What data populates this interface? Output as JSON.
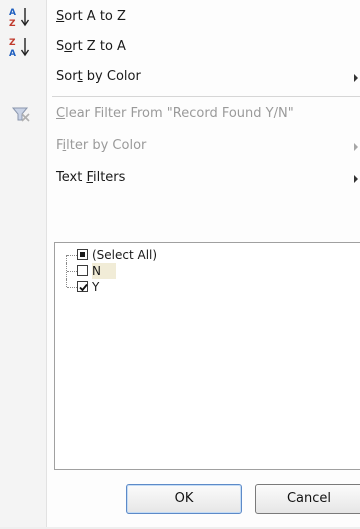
{
  "menu": {
    "sort_asc": {
      "pre": "",
      "key": "S",
      "post": "ort A to Z",
      "icon": "sort-a-to-z-icon"
    },
    "sort_desc": {
      "pre": "S",
      "key": "o",
      "post": "rt Z to A",
      "icon": "sort-z-to-a-icon"
    },
    "sort_color": {
      "pre": "Sor",
      "key": "t",
      "post": " by Color"
    },
    "clear_filter": {
      "pre": "",
      "key": "C",
      "post": "lear Filter From \"Record Found Y/N\"",
      "icon": "clear-filter-icon"
    },
    "filter_color": {
      "pre": "F",
      "key": "i",
      "post": "lter by Color"
    },
    "text_filters": {
      "pre": "Text ",
      "key": "F",
      "post": "ilters"
    }
  },
  "list": {
    "items": [
      {
        "label": "(Select All)",
        "state": "partial"
      },
      {
        "label": "N",
        "state": "unchecked"
      },
      {
        "label": "Y",
        "state": "checked"
      }
    ]
  },
  "buttons": {
    "ok": "OK",
    "cancel": "Cancel"
  },
  "colors": {
    "accent_blue": "#1f5fbf",
    "accent_red": "#c0392b",
    "disabled": "#9a9a9a"
  }
}
